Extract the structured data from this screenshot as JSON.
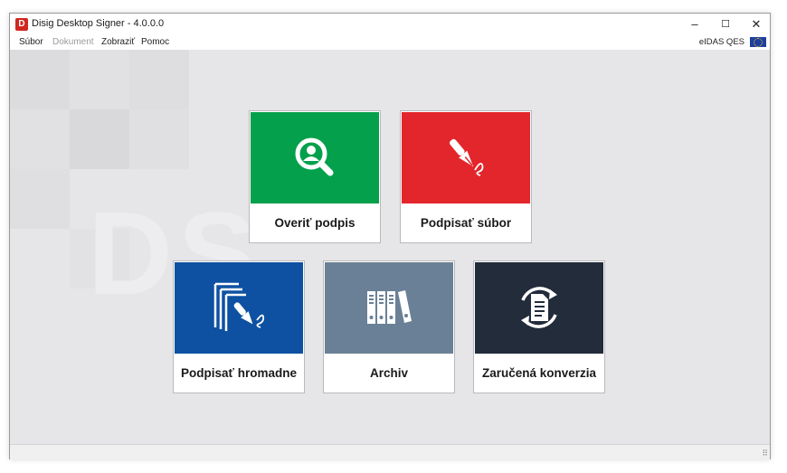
{
  "window": {
    "title": "Disig Desktop Signer - 4.0.0.0",
    "logo_letter": "D",
    "controls": {
      "minimize": "–",
      "maximize": "☐",
      "close": "✕"
    }
  },
  "menu": {
    "items": [
      {
        "label": "Súbor",
        "enabled": true
      },
      {
        "label": "Dokument",
        "enabled": false
      },
      {
        "label": "Zobraziť",
        "enabled": true
      },
      {
        "label": "Pomoc",
        "enabled": true
      }
    ],
    "eidas_label": "eIDAS QES"
  },
  "colors": {
    "verify": "#04a04b",
    "sign_file": "#e3262b",
    "sign_bulk": "#0e51a3",
    "archive": "#6a8096",
    "conversion": "#222c3a"
  },
  "tiles": {
    "verify": {
      "label": "Overiť podpis",
      "icon": "magnifier-user-icon"
    },
    "sign_file": {
      "label": "Podpisať súbor",
      "icon": "fountain-pen-icon"
    },
    "sign_bulk": {
      "label": "Podpisať hromadne",
      "icon": "stacked-pages-pen-icon"
    },
    "archive": {
      "label": "Archiv",
      "icon": "binders-icon"
    },
    "conversion": {
      "label": "Zaručená konverzia",
      "icon": "document-cycle-icon"
    }
  },
  "background": {
    "watermark": "DS"
  },
  "status_bar": {
    "grip": "⠿"
  }
}
